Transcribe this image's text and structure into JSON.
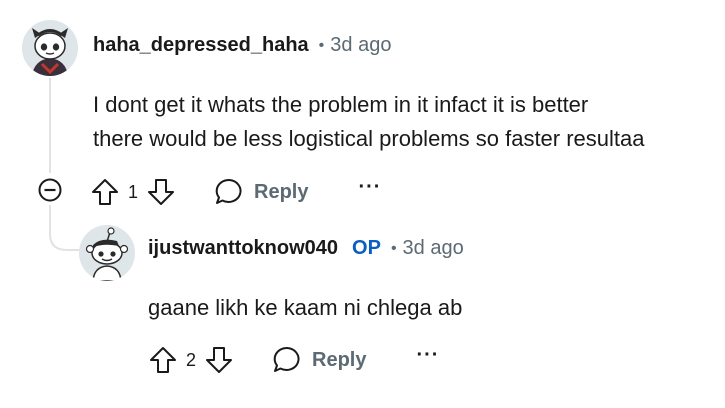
{
  "comments": [
    {
      "username": "haha_depressed_haha",
      "separator": "•",
      "time": "3d ago",
      "text_line1": "I dont get it whats the problem in it infact it is better",
      "text_line2": "there would be less logistical problems so faster resultaa",
      "votes": "1",
      "reply_label": "Reply",
      "more_label": "···"
    },
    {
      "username": "ijustwanttoknow040",
      "op_badge": "OP",
      "separator": "•",
      "time": "3d ago",
      "text": "gaane likh ke kaam ni chlega ab",
      "votes": "2",
      "reply_label": "Reply",
      "more_label": "···"
    }
  ],
  "icons": {
    "collapse": "collapse-thread-icon",
    "upvote": "upvote-arrow-icon",
    "downvote": "downvote-arrow-icon",
    "reply": "speech-bubble-icon",
    "more": "ellipsis-icon"
  },
  "colors": {
    "text": "#1a1a1b",
    "meta": "#5c6a73",
    "op_badge": "#0a5ec2",
    "thread_line": "#e0e3e6"
  }
}
